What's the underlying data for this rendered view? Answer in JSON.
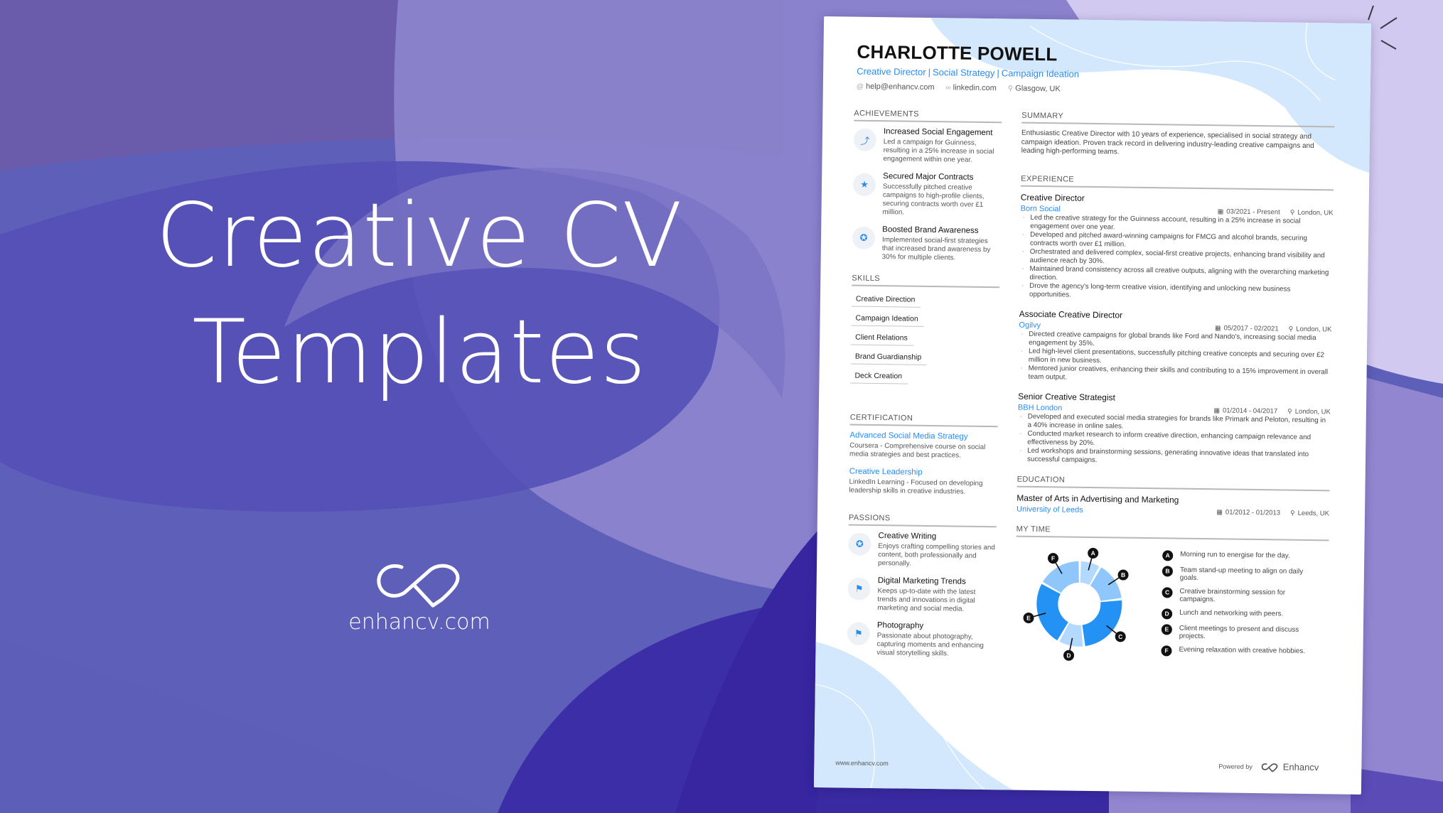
{
  "banner": {
    "title_line1": "Creative CV",
    "title_line2": "Templates",
    "brand_url": "enhancv.com",
    "colors": {
      "bg_dark": "#3526a0",
      "bg_mid": "#5d5fb8",
      "bg_light": "#9088d0",
      "bg_pale": "#d4ccf2"
    }
  },
  "resume": {
    "name": "CHARLOTTE POWELL",
    "titles": [
      "Creative Director",
      "Social Strategy",
      "Campaign Ideation"
    ],
    "title_separator": "|",
    "contacts": [
      {
        "icon": "at-icon",
        "glyph": "@",
        "text": "help@enhancv.com"
      },
      {
        "icon": "link-icon",
        "glyph": "🔗",
        "text": "linkedin.com"
      },
      {
        "icon": "location-pin-icon",
        "glyph": "⚲",
        "text": "Glasgow, UK"
      }
    ],
    "accent_color": "#2a8cf0",
    "achievements": {
      "heading": "ACHIEVEMENTS",
      "items": [
        {
          "icon": "growth-chart-icon",
          "glyph": "⤴",
          "title": "Increased Social Engagement",
          "desc": "Led a campaign for Guinness, resulting in a 25% increase in social engagement within one year."
        },
        {
          "icon": "star-icon",
          "glyph": "★",
          "title": "Secured Major Contracts",
          "desc": "Successfully pitched creative campaigns to high-profile clients, securing contracts worth over £1 million."
        },
        {
          "icon": "award-ribbon-icon",
          "glyph": "✪",
          "title": "Boosted Brand Awareness",
          "desc": "Implemented social-first strategies that increased brand awareness by 30% for multiple clients."
        }
      ]
    },
    "skills": {
      "heading": "SKILLS",
      "items": [
        "Creative Direction",
        "Campaign Ideation",
        "Client Relations",
        "Brand Guardianship",
        "Deck Creation"
      ]
    },
    "certification": {
      "heading": "CERTIFICATION",
      "items": [
        {
          "title": "Advanced Social Media Strategy",
          "desc": "Coursera - Comprehensive course on social media strategies and best practices."
        },
        {
          "title": "Creative Leadership",
          "desc": "LinkedIn Learning - Focused on developing leadership skills in creative industries."
        }
      ]
    },
    "passions": {
      "heading": "PASSIONS",
      "items": [
        {
          "icon": "award-ribbon-icon",
          "glyph": "✪",
          "title": "Creative Writing",
          "desc": "Enjoys crafting compelling stories and content, both professionally and personally."
        },
        {
          "icon": "flag-icon",
          "glyph": "⚑",
          "title": "Digital Marketing Trends",
          "desc": "Keeps up-to-date with the latest trends and innovations in digital marketing and social media."
        },
        {
          "icon": "flag-icon",
          "glyph": "⚑",
          "title": "Photography",
          "desc": "Passionate about photography, capturing moments and enhancing visual storytelling skills."
        }
      ]
    },
    "summary": {
      "heading": "SUMMARY",
      "text": "Enthusiastic Creative Director with 10 years of experience, specialised in social strategy and campaign ideation. Proven track record in delivering industry-leading creative campaigns and leading high-performing teams."
    },
    "experience": {
      "heading": "EXPERIENCE",
      "jobs": [
        {
          "role": "Creative Director",
          "company": "Born Social",
          "dates": "03/2021 - Present",
          "location": "London, UK",
          "bullets": [
            "Led the creative strategy for the Guinness account, resulting in a 25% increase in social engagement over one year.",
            "Developed and pitched award-winning campaigns for FMCG and alcohol brands, securing contracts worth over £1 million.",
            "Orchestrated and delivered complex, social-first creative projects, enhancing brand visibility and audience reach by 30%.",
            "Maintained brand consistency across all creative outputs, aligning with the overarching marketing direction.",
            "Drove the agency's long-term creative vision, identifying and unlocking new business opportunities."
          ]
        },
        {
          "role": "Associate Creative Director",
          "company": "Ogilvy",
          "dates": "05/2017 - 02/2021",
          "location": "London, UK",
          "bullets": [
            "Directed creative campaigns for global brands like Ford and Nando's, increasing social media engagement by 35%.",
            "Led high-level client presentations, successfully pitching creative concepts and securing over £2 million in new business.",
            "Mentored junior creatives, enhancing their skills and contributing to a 15% improvement in overall team output."
          ]
        },
        {
          "role": "Senior Creative Strategist",
          "company": "BBH London",
          "dates": "01/2014 - 04/2017",
          "location": "London, UK",
          "bullets": [
            "Developed and executed social media strategies for brands like Primark and Peloton, resulting in a 40% increase in online sales.",
            "Conducted market research to inform creative direction, enhancing campaign relevance and effectiveness by 20%.",
            "Led workshops and brainstorming sessions, generating innovative ideas that translated into successful campaigns."
          ]
        }
      ]
    },
    "education": {
      "heading": "EDUCATION",
      "items": [
        {
          "degree": "Master of Arts in Advertising and Marketing",
          "school": "University of Leeds",
          "dates": "01/2012 - 01/2013",
          "location": "Leeds, UK"
        }
      ]
    },
    "my_time": {
      "heading": "MY TIME",
      "legend": [
        {
          "key": "A",
          "text": "Morning run to energise for the day."
        },
        {
          "key": "B",
          "text": "Team stand-up meeting to align on daily goals."
        },
        {
          "key": "C",
          "text": "Creative brainstorming session for campaigns."
        },
        {
          "key": "D",
          "text": "Lunch and networking with peers."
        },
        {
          "key": "E",
          "text": "Client meetings to present and discuss projects."
        },
        {
          "key": "F",
          "text": "Evening relaxation with creative hobbies."
        }
      ]
    },
    "footer": {
      "url": "www.enhancv.com",
      "powered_by": "Powered by",
      "brand": "Enhancv"
    }
  },
  "chart_data": {
    "type": "pie",
    "title": "MY TIME",
    "variant": "donut",
    "categories": [
      "A",
      "B",
      "C",
      "D",
      "E",
      "F"
    ],
    "values": [
      8,
      15,
      25,
      10,
      25,
      17
    ],
    "colors": [
      "#b3dafe",
      "#8fc7fc",
      "#2492f5",
      "#b3dafe",
      "#2492f5",
      "#8fc7fc"
    ],
    "legend_placement": "right"
  }
}
